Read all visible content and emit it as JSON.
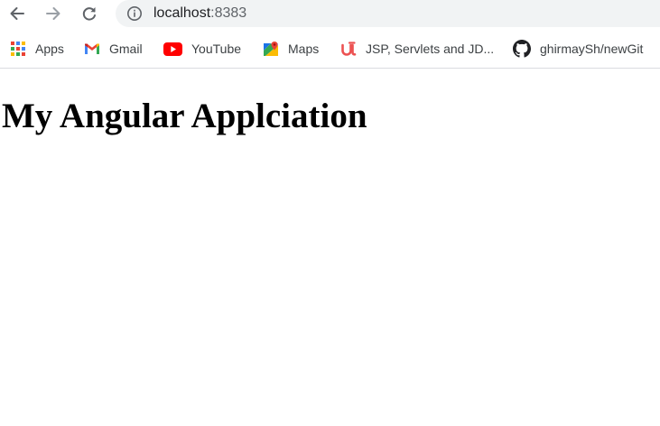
{
  "browser": {
    "nav": {
      "back_icon": "arrow-left-icon",
      "forward_icon": "arrow-right-icon",
      "reload_icon": "reload-icon"
    },
    "address": {
      "host": "localhost",
      "port": ":8383",
      "icon": "info-icon"
    },
    "bookmarks": [
      {
        "label": "Apps",
        "icon": "apps-grid-icon"
      },
      {
        "label": "Gmail",
        "icon": "gmail-icon"
      },
      {
        "label": "YouTube",
        "icon": "youtube-icon"
      },
      {
        "label": "Maps",
        "icon": "maps-icon"
      },
      {
        "label": "JSP, Servlets and JD...",
        "icon": "udemy-icon"
      },
      {
        "label": "ghirmaySh/newGit",
        "icon": "github-icon"
      }
    ]
  },
  "page": {
    "heading": "My Angular Applciation"
  },
  "colors": {
    "omnibox_bg": "#f1f3f4",
    "bookmark_text": "#3c4043",
    "youtube_red": "#ff0000",
    "udemy_red": "#ec5252"
  }
}
